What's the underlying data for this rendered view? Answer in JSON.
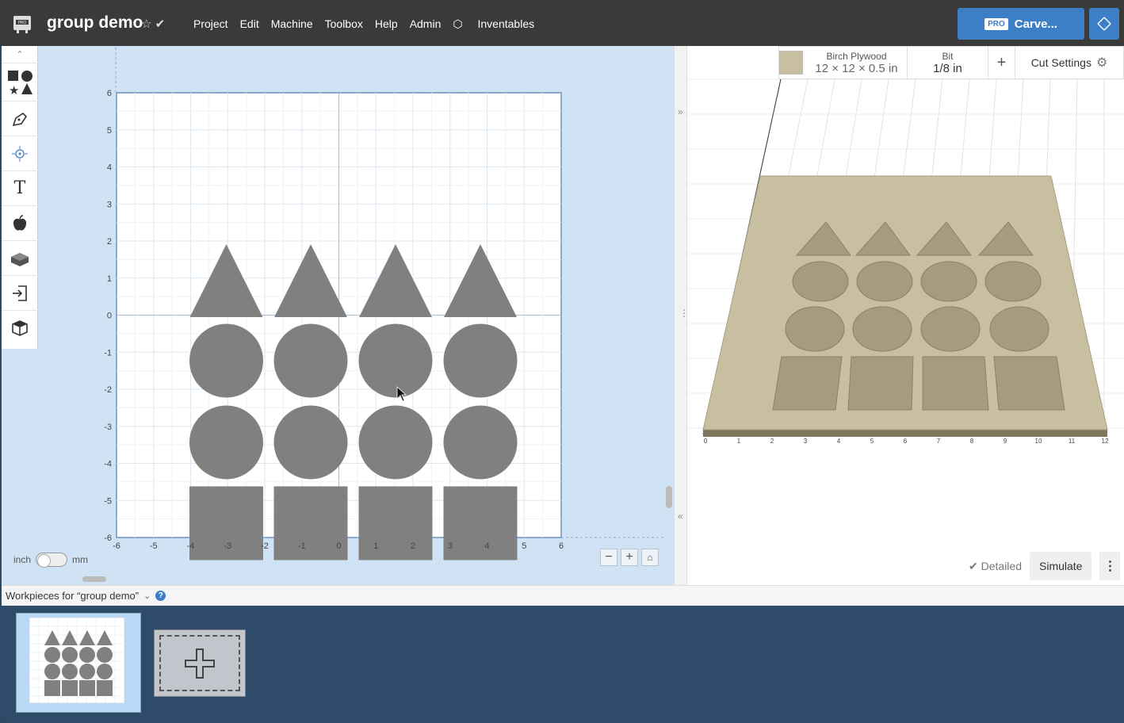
{
  "app": {
    "title": "group demo",
    "menu": [
      "Project",
      "Edit",
      "Machine",
      "Toolbox",
      "Help",
      "Admin"
    ],
    "inventables_label": "Inventables",
    "carve_pro_badge": "PRO",
    "carve_label": "Carve..."
  },
  "design": {
    "units_left": "inch",
    "units_right": "mm",
    "y_ticks": [
      "6",
      "5",
      "4",
      "3",
      "2",
      "1",
      "0",
      "-1",
      "-2",
      "-3",
      "-4",
      "-5",
      "-6"
    ],
    "x_ticks": [
      "-6",
      "-5",
      "-4",
      "-3",
      "-2",
      "-1",
      "0",
      "1",
      "2",
      "3",
      "4",
      "5",
      "6"
    ],
    "shapes_per_row": 4,
    "rows": [
      "triangle",
      "circle",
      "circle",
      "square"
    ],
    "shape_color": "#808080"
  },
  "preview": {
    "material_label": "Birch Plywood",
    "material_size": "12 × 12 × 0.5 in",
    "bit_label": "Bit",
    "bit_size": "1/8 in",
    "add_label": "+",
    "cut_settings_label": "Cut Settings",
    "detailed_label": "Detailed",
    "simulate_label": "Simulate",
    "axis_ticks": [
      "0",
      "1",
      "2",
      "3",
      "4",
      "5",
      "6",
      "7",
      "8",
      "9",
      "10",
      "11",
      "12"
    ]
  },
  "workpieces": {
    "header": "Workpieces for “group demo”",
    "help": "?"
  }
}
